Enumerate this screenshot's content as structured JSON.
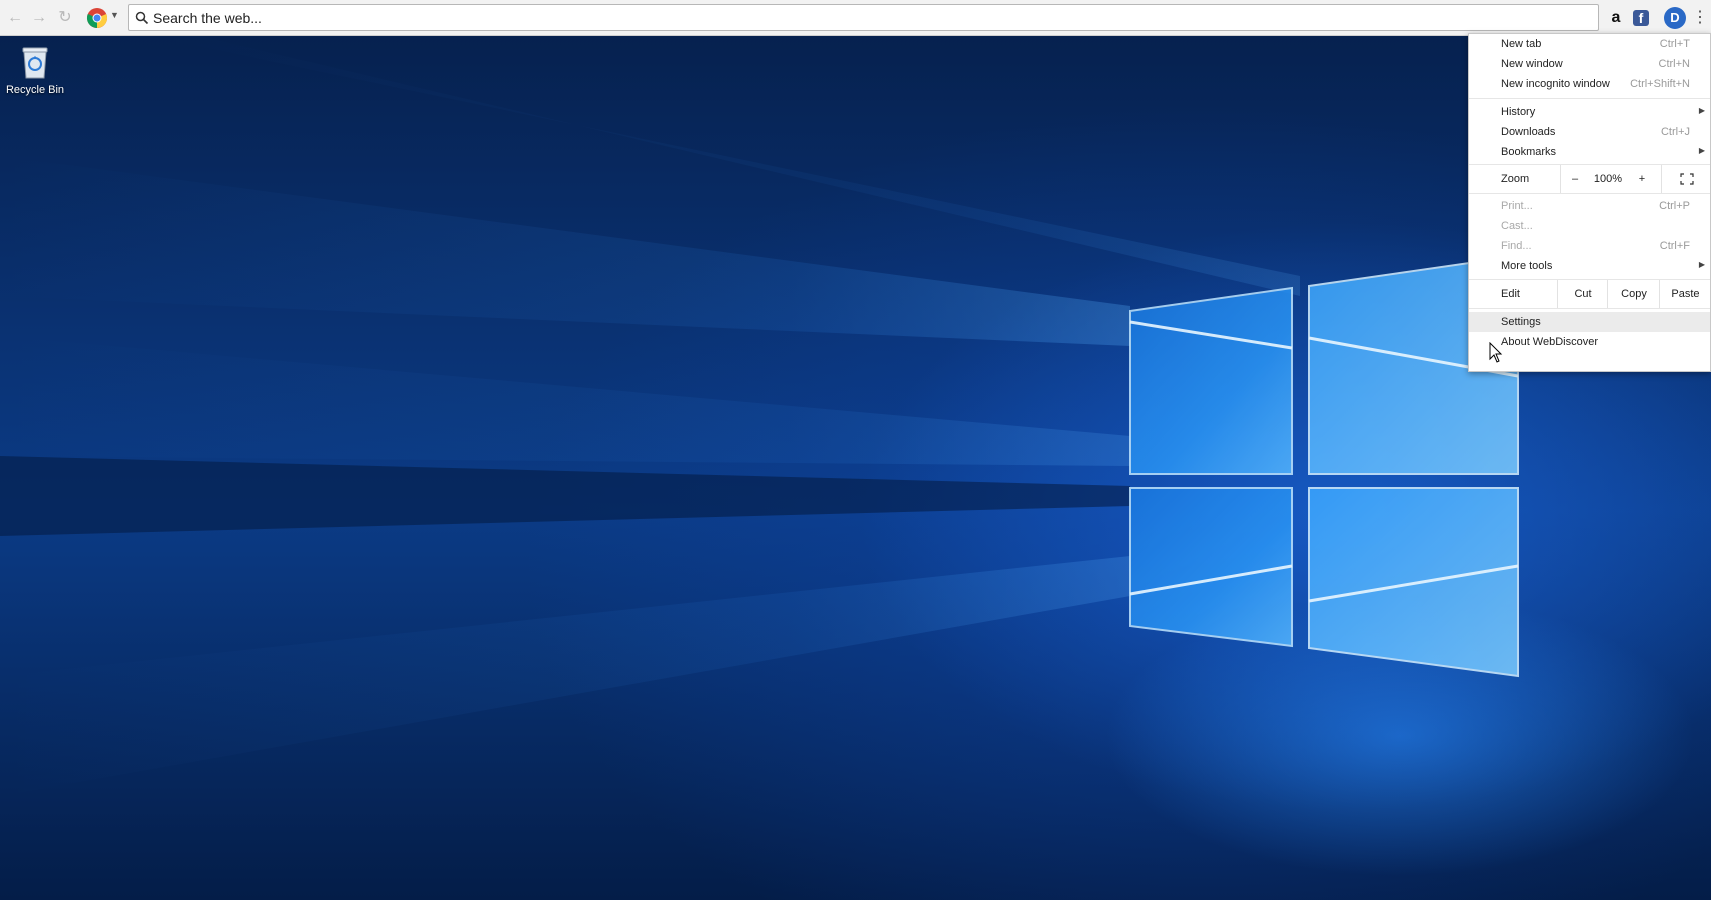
{
  "toolbar": {
    "omnibox_text": "Search the web...",
    "back_glyph": "←",
    "forward_glyph": "→",
    "reload_glyph": "↻",
    "menu_glyph": "⋮",
    "extensions": [
      {
        "name": "amazon-extension-icon",
        "glyph": "a"
      },
      {
        "name": "facebook-extension-icon",
        "glyph": "f"
      },
      {
        "name": "webdiscover-extension-icon",
        "glyph": "D"
      }
    ]
  },
  "desktop": {
    "icons": [
      {
        "label": "Recycle Bin",
        "icon": "recycle-bin-icon"
      }
    ]
  },
  "menu": {
    "new_tab": {
      "label": "New tab",
      "shortcut": "Ctrl+T"
    },
    "new_window": {
      "label": "New window",
      "shortcut": "Ctrl+N"
    },
    "new_incognito": {
      "label": "New incognito window",
      "shortcut": "Ctrl+Shift+N"
    },
    "history": {
      "label": "History"
    },
    "downloads": {
      "label": "Downloads",
      "shortcut": "Ctrl+J"
    },
    "bookmarks": {
      "label": "Bookmarks"
    },
    "zoom": {
      "label": "Zoom",
      "minus": "–",
      "value": "100%",
      "plus": "+"
    },
    "print": {
      "label": "Print...",
      "shortcut": "Ctrl+P"
    },
    "cast": {
      "label": "Cast..."
    },
    "find": {
      "label": "Find...",
      "shortcut": "Ctrl+F"
    },
    "more_tools": {
      "label": "More tools"
    },
    "edit": {
      "label": "Edit",
      "cut": "Cut",
      "copy": "Copy",
      "paste": "Paste"
    },
    "settings": {
      "label": "Settings"
    },
    "about": {
      "label": "About WebDiscover"
    }
  },
  "colors": {
    "toolbar_bg": "#f2f2f2",
    "wallpaper_dark": "#041d48",
    "wallpaper_glow": "#1e90ff",
    "menu_hover": "#ebebeb"
  }
}
